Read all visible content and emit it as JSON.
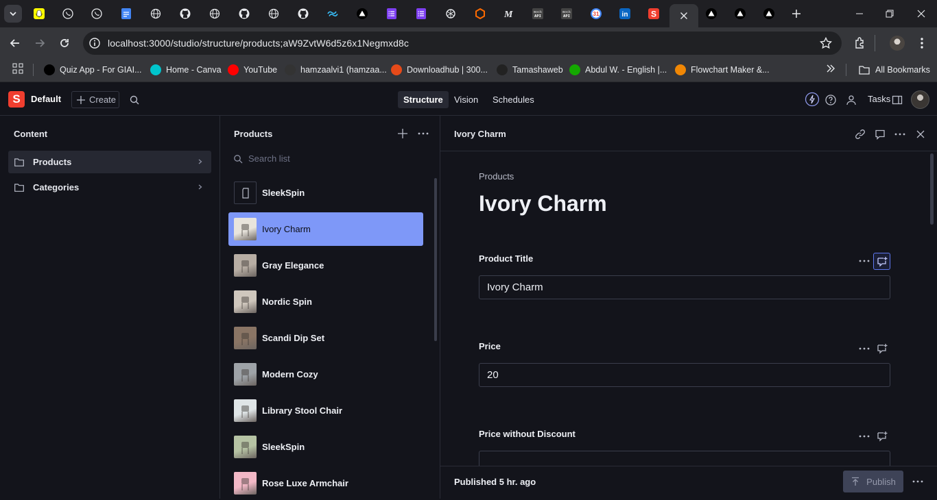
{
  "browser": {
    "tabs": [
      {
        "icon": "snapchat-icon",
        "color": "#fffc00"
      },
      {
        "icon": "whatsapp-icon",
        "color": "#1f1f23"
      },
      {
        "icon": "whatsapp-icon",
        "color": "#25d366"
      },
      {
        "icon": "google-docs-icon",
        "color": "#4285f4"
      },
      {
        "icon": "globe-icon",
        "color": "#1f1f23"
      },
      {
        "icon": "github-icon",
        "color": "#1f1f23"
      },
      {
        "icon": "globe-icon",
        "color": "#1f1f23"
      },
      {
        "icon": "github-icon",
        "color": "#1f1f23"
      },
      {
        "icon": "globe-icon",
        "color": "#1f1f23"
      },
      {
        "icon": "github-icon",
        "color": "#1f1f23"
      },
      {
        "icon": "tailwind-icon",
        "color": "#38bdf8"
      },
      {
        "icon": "vercel-icon",
        "color": "#000000"
      },
      {
        "icon": "forms-icon",
        "color": "#7e3ff2"
      },
      {
        "icon": "forms-icon",
        "color": "#7e3ff2"
      },
      {
        "icon": "openai-icon",
        "color": "#1f1f23"
      },
      {
        "icon": "sourcegraph-icon",
        "color": "#ff6a00"
      },
      {
        "icon": "medium-icon",
        "color": "#1f1f23"
      },
      {
        "icon": "mock-api-icon",
        "color": "#444444",
        "text": "mock API"
      },
      {
        "icon": "mock-api-icon",
        "color": "#444444",
        "text": "mock API"
      },
      {
        "icon": "calendar-icon",
        "color": "#4285f4",
        "text": "31"
      },
      {
        "icon": "linkedin-icon",
        "color": "#0a66c2",
        "text": "in"
      },
      {
        "icon": "sanity-icon",
        "color": "#f03e2f",
        "text": "S"
      },
      {
        "icon": "close-icon",
        "color": "#35363a",
        "active": true
      },
      {
        "icon": "vercel-icon",
        "color": "#000000"
      },
      {
        "icon": "vercel-icon",
        "color": "#000000"
      },
      {
        "icon": "vercel-icon",
        "color": "#000000"
      }
    ],
    "address": {
      "host": "localhost",
      "path": ":3000/studio/structure/products;aW9ZvtW6d5z6x1Negmxd8c"
    },
    "bookmarks": [
      {
        "label": "Quiz App - For GIAI...",
        "color": "#000000"
      },
      {
        "label": "Home - Canva",
        "color": "#00c4cc"
      },
      {
        "label": "YouTube",
        "color": "#ff0000"
      },
      {
        "label": "hamzaalvi1 (hamzaa...",
        "color": "#333333"
      },
      {
        "label": "Downloadhub | 300...",
        "color": "#e64a19"
      },
      {
        "label": "Tamashaweb",
        "color": "#222222"
      },
      {
        "label": "Abdul W. - English |...",
        "color": "#14a800"
      },
      {
        "label": "Flowchart Maker &...",
        "color": "#f08705"
      }
    ],
    "all_bookmarks": "All Bookmarks"
  },
  "studio": {
    "workspace": "Default",
    "create_label": "Create",
    "nav": [
      "Structure",
      "Vision",
      "Schedules"
    ],
    "tasks_label": "Tasks"
  },
  "content_pane": {
    "title": "Content",
    "items": [
      {
        "label": "Products",
        "selected": true
      },
      {
        "label": "Categories",
        "selected": false
      }
    ]
  },
  "products_pane": {
    "title": "Products",
    "search_placeholder": "Search list",
    "items": [
      {
        "label": "SleekSpin",
        "thumb": "document-icon"
      },
      {
        "label": "Ivory Charm",
        "thumb": "#e8e4dc",
        "selected": true
      },
      {
        "label": "Gray Elegance",
        "thumb": "#b8aea4"
      },
      {
        "label": "Nordic Spin",
        "thumb": "#cfc7bd"
      },
      {
        "label": "Scandi Dip Set",
        "thumb": "#8a7565"
      },
      {
        "label": "Modern Cozy",
        "thumb": "#9ea3a8"
      },
      {
        "label": "Library Stool Chair",
        "thumb": "#dfe5e7"
      },
      {
        "label": "SleekSpin",
        "thumb": "#b6c3a4"
      },
      {
        "label": "Rose Luxe Armchair",
        "thumb": "#f2b8c6"
      }
    ]
  },
  "document": {
    "header_title": "Ivory Charm",
    "breadcrumb": "Products",
    "title": "Ivory Charm",
    "fields": [
      {
        "label": "Product Title",
        "value": "Ivory Charm"
      },
      {
        "label": "Price",
        "value": "20"
      },
      {
        "label": "Price without Discount",
        "value": ""
      }
    ],
    "status": "Published 5 hr. ago",
    "publish_label": "Publish"
  }
}
